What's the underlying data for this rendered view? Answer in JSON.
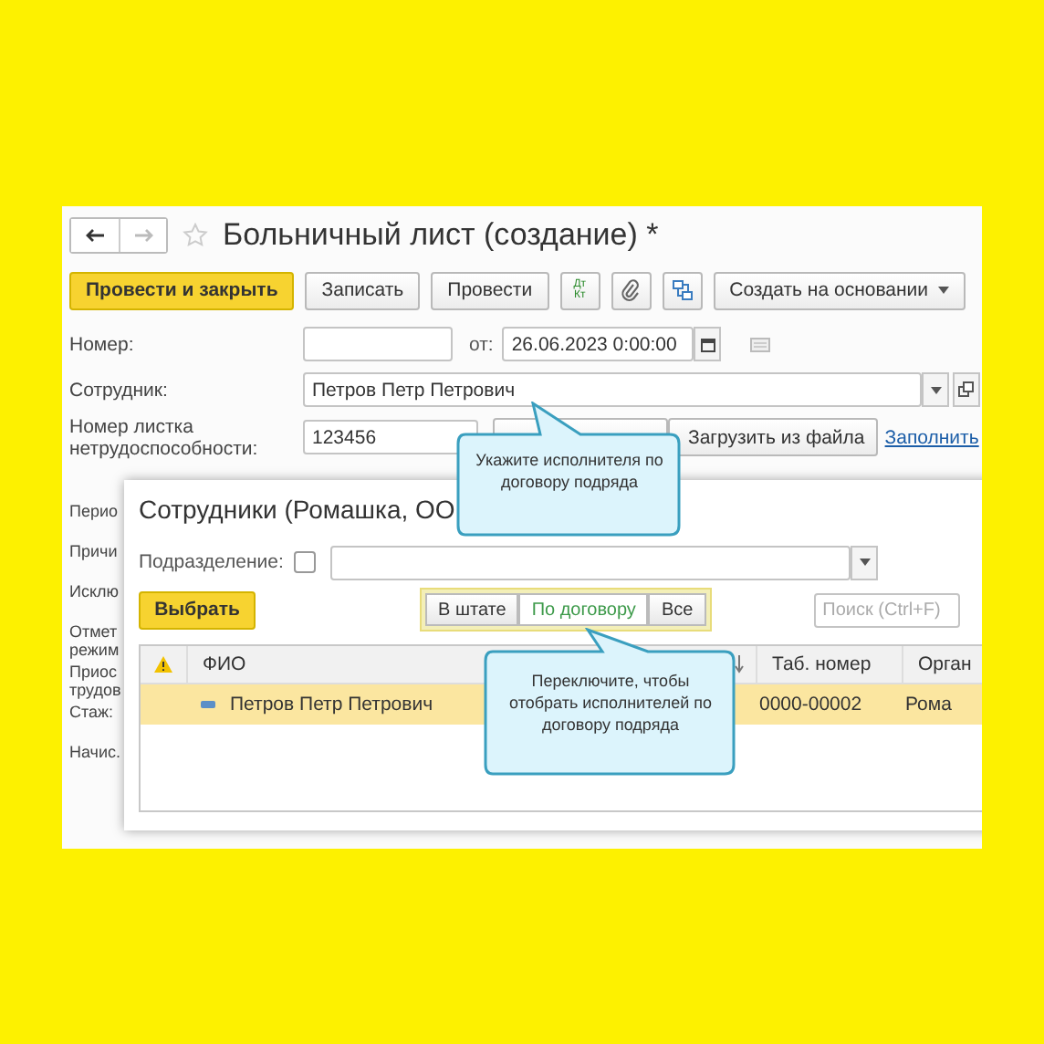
{
  "window": {
    "title": "Больничный лист (создание) *"
  },
  "toolbar": [
    {
      "kind": "primary",
      "label": "Провести и закрыть"
    },
    {
      "kind": "text",
      "label": "Записать"
    },
    {
      "kind": "text",
      "label": "Провести"
    },
    {
      "kind": "dtkt",
      "label": "Дт",
      "sublabel": "Кт"
    },
    {
      "kind": "clip"
    },
    {
      "kind": "structure"
    },
    {
      "kind": "menu",
      "label": "Создать на основании"
    }
  ],
  "form": {
    "number_label": "Номер:",
    "date_label": "от:",
    "date_value": "26.06.2023  0:00:00",
    "employee_label": "Сотрудник:",
    "employee_value": "Петров Петр Петрович",
    "sheet_label": "Номер листка нетрудоспособности:",
    "sheet_value": "123456",
    "load_button": "Загрузить из файла",
    "fill_link": "Заполнить",
    "hidden_labels": [
      [
        "Перио"
      ],
      [
        "Причи"
      ],
      [
        "Исклю"
      ],
      [
        "Отмет",
        "режим"
      ],
      [
        "Приос",
        "трудов"
      ],
      [
        "Стаж:"
      ],
      [
        "Начис."
      ]
    ]
  },
  "dialog": {
    "title": "Сотрудники (Ромашка, ОО",
    "subdivision_label": "Подразделение:",
    "subdivision_checked": false,
    "select_button": "Выбрать",
    "filters": [
      {
        "label": "В штате",
        "selected": false
      },
      {
        "label": "По договору",
        "selected": true
      },
      {
        "label": "Все",
        "selected": false
      }
    ],
    "search_placeholder": "Поиск (Ctrl+F)",
    "columns": [
      "ФИО",
      "Таб. номер",
      "Орган"
    ],
    "rows": [
      {
        "name": "Петров Петр Петрович",
        "tab_number": "0000-00002",
        "org": "Рома",
        "selected": true
      }
    ]
  },
  "tooltips": [
    {
      "text": "Укажите исполнителя по договору подряда"
    },
    {
      "text": "Переключите, чтобы отобрать исполнителей по договору подряда"
    }
  ]
}
